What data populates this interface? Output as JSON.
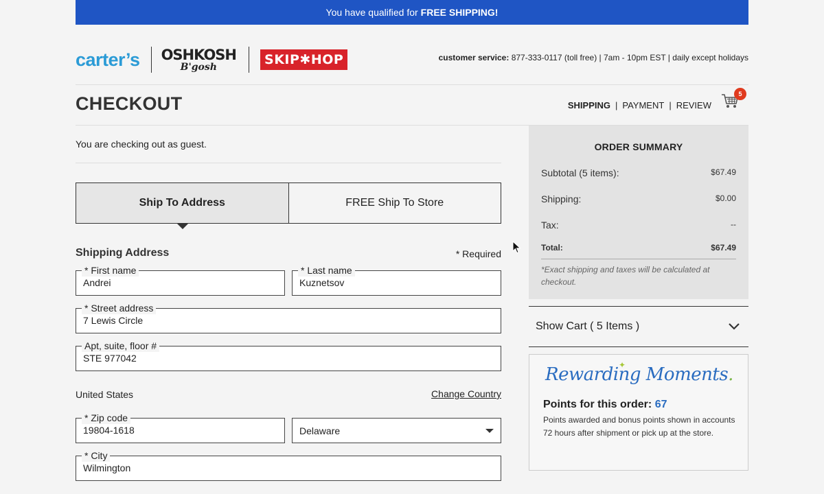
{
  "banner": {
    "text": "You have qualified for",
    "bold": "FREE SHIPPING!"
  },
  "logos": {
    "carters": "carter’s",
    "oshkosh_top": "OSHKOSH",
    "oshkosh_bottom": "B'gosh",
    "skiphop": "SKIP✱HOP"
  },
  "customer_service": {
    "label": "customer service:",
    "info": "877-333-0117 (toll free) | 7am - 10pm EST | daily except holidays"
  },
  "page_title": "CHECKOUT",
  "steps": [
    "SHIPPING",
    "|",
    "PAYMENT",
    "|",
    "REVIEW"
  ],
  "cart": {
    "count": "5",
    "icon": "cart-icon"
  },
  "guest_text": "You are checking out as guest.",
  "tabs": [
    {
      "label": "Ship To Address",
      "active": true
    },
    {
      "label": "FREE Ship To Store",
      "active": false
    }
  ],
  "shipping": {
    "title": "Shipping Address",
    "required": "* Required",
    "first_name": {
      "label": "* First name",
      "value": "Andrei"
    },
    "last_name": {
      "label": "* Last name",
      "value": "Kuznetsov"
    },
    "street": {
      "label": "* Street address",
      "value": "7 Lewis Circle"
    },
    "apt": {
      "label": "Apt, suite, floor #",
      "value": "STE 977042"
    },
    "country": "United States",
    "change_country": "Change Country",
    "zip": {
      "label": "* Zip code",
      "value": "19804-1618"
    },
    "state": {
      "value": "Delaware"
    },
    "city": {
      "label": "* City",
      "value": "Wilmington"
    }
  },
  "summary": {
    "title": "ORDER SUMMARY",
    "subtotal_label": "Subtotal (5 items):",
    "subtotal_value": "$67.49",
    "shipping_label": "Shipping:",
    "shipping_value": "$0.00",
    "tax_label": "Tax:",
    "tax_value": "--",
    "total_label": "Total:",
    "total_value": "$67.49",
    "note": "*Exact shipping and taxes will be calculated at checkout."
  },
  "show_cart": "Show Cart ( 5 Items )",
  "rewards": {
    "logo": "Rewarding Moments",
    "points_label": "Points for this order:",
    "points_value": "67",
    "description": "Points awarded and bonus points shown in accounts 72 hours after shipment or pick up at the store."
  },
  "colors": {
    "banner": "#1f55c4",
    "carters": "#2b9bd6",
    "skiphop": "#d8232a",
    "badge": "#e03a1e",
    "rewards_blue": "#2a6cc0"
  }
}
